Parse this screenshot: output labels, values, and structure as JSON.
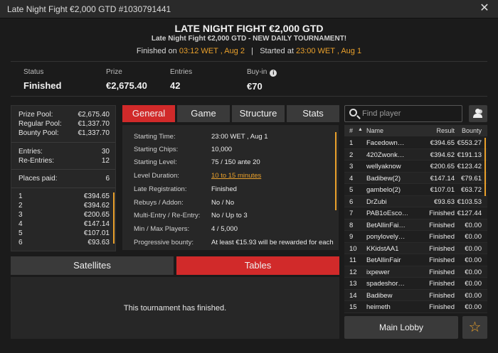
{
  "window": {
    "title": "Late Night Fight €2,000 GTD #1030791441",
    "close_icon": "close-icon"
  },
  "header": {
    "title": "LATE NIGHT FIGHT €2,000 GTD",
    "subtitle": "Late Night Fight €2,000 GTD  - NEW DAILY TOURNAMENT!",
    "finished_label": "Finished on",
    "finished_value": "03:12 WET , Aug 2",
    "separator": "|",
    "started_label": "Started at",
    "started_value": "23:00 WET , Aug 1"
  },
  "summary": {
    "status_label": "Status",
    "status_value": "Finished",
    "prize_label": "Prize",
    "prize_value": "€2,675.40",
    "entries_label": "Entries",
    "entries_value": "42",
    "buyin_label": "Buy-in",
    "buyin_value": "€70"
  },
  "left": {
    "prize_pool_label": "Prize Pool:",
    "prize_pool_value": "€2,675.40",
    "regular_pool_label": "Regular Pool:",
    "regular_pool_value": "€1,337.70",
    "bounty_pool_label": "Bounty Pool:",
    "bounty_pool_value": "€1,337.70",
    "entries_label": "Entries:",
    "entries_value": "30",
    "reentries_label": "Re-Entries:",
    "reentries_value": "12",
    "places_label": "Places paid:",
    "places_value": "6",
    "payouts": [
      {
        "place": "1",
        "amount": "€394.65"
      },
      {
        "place": "2",
        "amount": "€394.62"
      },
      {
        "place": "3",
        "amount": "€200.65"
      },
      {
        "place": "4",
        "amount": "€147.14"
      },
      {
        "place": "5",
        "amount": "€107.01"
      },
      {
        "place": "6",
        "amount": "€93.63"
      }
    ]
  },
  "tabs": [
    "General",
    "Game",
    "Structure",
    "Stats"
  ],
  "general": [
    {
      "k": "Starting Time:",
      "v": "23:00 WET , Aug 1"
    },
    {
      "k": "Starting Chips:",
      "v": "10,000"
    },
    {
      "k": "Starting Level:",
      "v": "75 / 150 ante 20"
    },
    {
      "k": "Level Duration:",
      "v": "10 to 15 minutes"
    },
    {
      "k": "Late Registration:",
      "v": "Finished"
    },
    {
      "k": "Rebuys / Addon:",
      "v": "No / No"
    },
    {
      "k": "Multi-Entry / Re-Entry:",
      "v": "No / Up to 3"
    },
    {
      "k": "Min / Max Players:",
      "v": "4 / 5,000"
    },
    {
      "k": "Progressive bounty:",
      "v": "At least €15.93 will be rewarded for each"
    }
  ],
  "bottom": {
    "tabs": [
      "Satellites",
      "Tables"
    ],
    "message": "This tournament has finished."
  },
  "search": {
    "placeholder": "Find player"
  },
  "players": {
    "headers": {
      "rank": "#",
      "sort": "▲",
      "name": "Name",
      "result": "Result",
      "bounty": "Bounty"
    },
    "rows": [
      {
        "rank": "1",
        "name": "Facedown…",
        "result": "€394.65",
        "bounty": "€553.27"
      },
      {
        "rank": "2",
        "name": "420Zwonk…",
        "result": "€394.62",
        "bounty": "€191.13"
      },
      {
        "rank": "3",
        "name": "wellyaknow",
        "result": "€200.65",
        "bounty": "€123.42"
      },
      {
        "rank": "4",
        "name": "Badibew(2)",
        "result": "€147.14",
        "bounty": "€79.61"
      },
      {
        "rank": "5",
        "name": "gambelo(2)",
        "result": "€107.01",
        "bounty": "€63.72"
      },
      {
        "rank": "6",
        "name": "DrZubi",
        "result": "€93.63",
        "bounty": "€103.53"
      },
      {
        "rank": "7",
        "name": "PAB1oEsco…",
        "result": "Finished",
        "bounty": "€127.44"
      },
      {
        "rank": "8",
        "name": "BetAllinFai…",
        "result": "Finished",
        "bounty": "€0.00"
      },
      {
        "rank": "9",
        "name": "ponylovely…",
        "result": "Finished",
        "bounty": "€0.00"
      },
      {
        "rank": "10",
        "name": "KKidstAA1",
        "result": "Finished",
        "bounty": "€0.00"
      },
      {
        "rank": "11",
        "name": "BetAllinFair",
        "result": "Finished",
        "bounty": "€0.00"
      },
      {
        "rank": "12",
        "name": "ixpewer",
        "result": "Finished",
        "bounty": "€0.00"
      },
      {
        "rank": "13",
        "name": "spadeshor…",
        "result": "Finished",
        "bounty": "€0.00"
      },
      {
        "rank": "14",
        "name": "Badibew",
        "result": "Finished",
        "bounty": "€0.00"
      },
      {
        "rank": "15",
        "name": "heimeth",
        "result": "Finished",
        "bounty": "€0.00"
      }
    ]
  },
  "buttons": {
    "main_lobby": "Main Lobby",
    "star_icon": "star-icon"
  },
  "colors": {
    "accent": "#d12a2a",
    "highlight": "#e9a02b",
    "background": "#1b1b1b"
  }
}
